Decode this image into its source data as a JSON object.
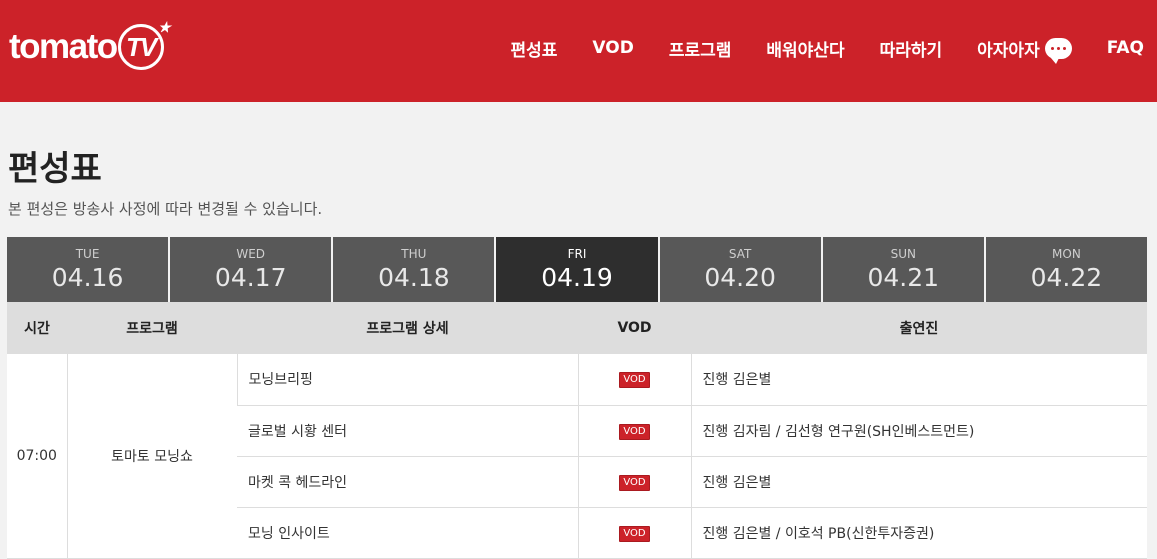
{
  "header": {
    "logo_text": "tomato",
    "logo_tv": "TV",
    "nav": [
      {
        "label": "편성표"
      },
      {
        "label": "VOD"
      },
      {
        "label": "프로그램"
      },
      {
        "label": "배워야산다"
      },
      {
        "label": "따라하기"
      },
      {
        "label": "아자아자"
      },
      {
        "label": "FAQ"
      }
    ]
  },
  "page": {
    "title": "편성표",
    "subtitle": "본 편성은 방송사 사정에 따라 변경될 수 있습니다."
  },
  "days": [
    {
      "dow": "TUE",
      "date": "04.16",
      "active": false
    },
    {
      "dow": "WED",
      "date": "04.17",
      "active": false
    },
    {
      "dow": "THU",
      "date": "04.18",
      "active": false
    },
    {
      "dow": "FRI",
      "date": "04.19",
      "active": true
    },
    {
      "dow": "SAT",
      "date": "04.20",
      "active": false
    },
    {
      "dow": "SUN",
      "date": "04.21",
      "active": false
    },
    {
      "dow": "MON",
      "date": "04.22",
      "active": false
    }
  ],
  "table": {
    "headers": {
      "time": "시간",
      "program": "프로그램",
      "detail": "프로그램 상세",
      "vod": "VOD",
      "cast": "출연진"
    },
    "time": "07:00",
    "program": "토마토 모닝쇼",
    "vod_label": "VOD",
    "rows": [
      {
        "detail": "모닝브리핑",
        "cast": "진행 김은별"
      },
      {
        "detail": "글로벌 시황 센터",
        "cast": "진행 김자림 / 김선형 연구원(SH인베스트먼트)"
      },
      {
        "detail": "마켓 콕 헤드라인",
        "cast": "진행 김은별"
      },
      {
        "detail": "모닝 인사이트",
        "cast": "진행 김은별 / 이호석 PB(신한투자증권)"
      }
    ]
  },
  "colors": {
    "brand": "#cc2229",
    "day_bg": "#585858",
    "day_active_bg": "#2e2e2e"
  }
}
